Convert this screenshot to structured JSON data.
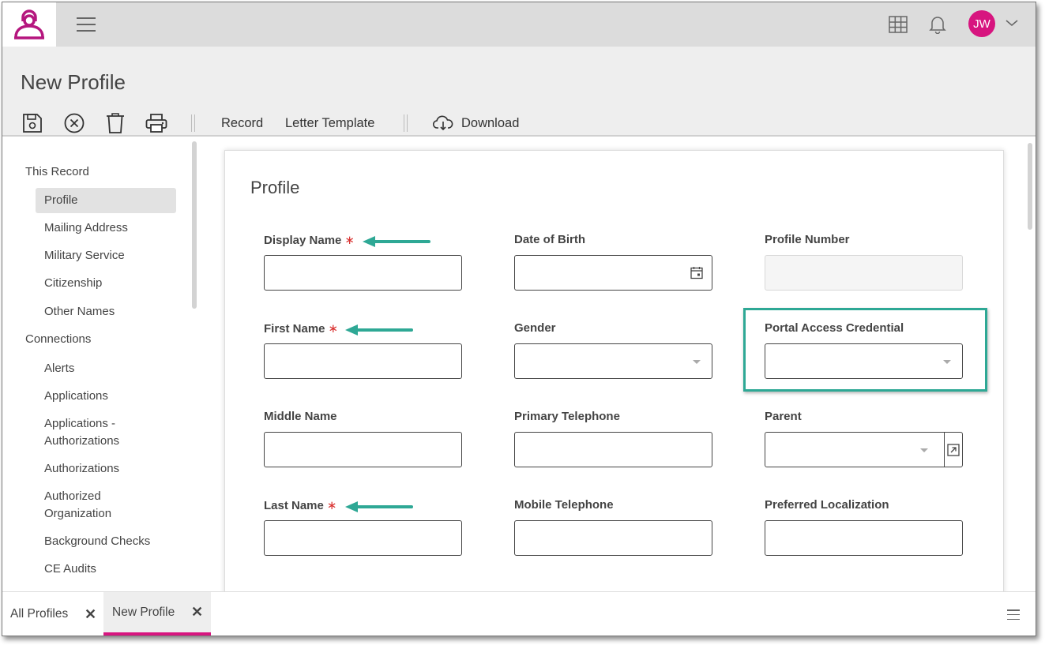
{
  "app": {
    "logo_icon": "user-lock-logo-icon",
    "brand_color": "#b5167e",
    "accent_color": "#d7157f"
  },
  "topbar": {
    "menu_icon": "hamburger-icon",
    "grid_icon": "grid-icon",
    "bell_icon": "bell-icon",
    "avatar_initials": "JW",
    "avatar_chevron_icon": "chevron-down-icon"
  },
  "page": {
    "title": "New Profile"
  },
  "toolbar": {
    "icons": [
      "save-icon",
      "cancel-icon",
      "trash-icon",
      "print-icon"
    ],
    "record_label": "Record",
    "letter_template_label": "Letter Template",
    "download_label": "Download",
    "download_icon": "cloud-download-icon"
  },
  "sidebar": {
    "groups": [
      {
        "label": "This Record",
        "items": [
          {
            "label": "Profile",
            "active": true
          },
          {
            "label": "Mailing Address"
          },
          {
            "label": "Military Service"
          },
          {
            "label": "Citizenship"
          },
          {
            "label": "Other Names"
          }
        ]
      },
      {
        "label": "Connections",
        "items": [
          {
            "label": "Alerts"
          },
          {
            "label": "Applications"
          },
          {
            "label": "Applications - Authorizations"
          },
          {
            "label": "Authorizations"
          },
          {
            "label": "Authorized Organization"
          },
          {
            "label": "Background Checks"
          },
          {
            "label": "CE Audits"
          }
        ]
      }
    ]
  },
  "form": {
    "title": "Profile",
    "required_marker": "∗",
    "fields": {
      "display_name": {
        "label": "Display Name",
        "required": true,
        "value": ""
      },
      "date_of_birth": {
        "label": "Date of Birth",
        "value": ""
      },
      "profile_number": {
        "label": "Profile Number",
        "value": ""
      },
      "first_name": {
        "label": "First Name",
        "required": true,
        "value": ""
      },
      "gender": {
        "label": "Gender",
        "value": ""
      },
      "portal_access_credential": {
        "label": "Portal Access Credential",
        "value": ""
      },
      "middle_name": {
        "label": "Middle Name",
        "value": ""
      },
      "primary_telephone": {
        "label": "Primary Telephone",
        "value": ""
      },
      "parent": {
        "label": "Parent",
        "value": ""
      },
      "last_name": {
        "label": "Last Name",
        "required": true,
        "value": ""
      },
      "mobile_telephone": {
        "label": "Mobile Telephone",
        "value": ""
      },
      "preferred_localization": {
        "label": "Preferred Localization",
        "value": ""
      }
    },
    "annotation_color": "#2ea895"
  },
  "bottom_tabs": {
    "tabs": [
      {
        "label": "All Profiles",
        "close": "✕",
        "active": false
      },
      {
        "label": "New Profile",
        "close": "✕",
        "active": true
      }
    ],
    "menu_icon": "list-menu-icon"
  }
}
